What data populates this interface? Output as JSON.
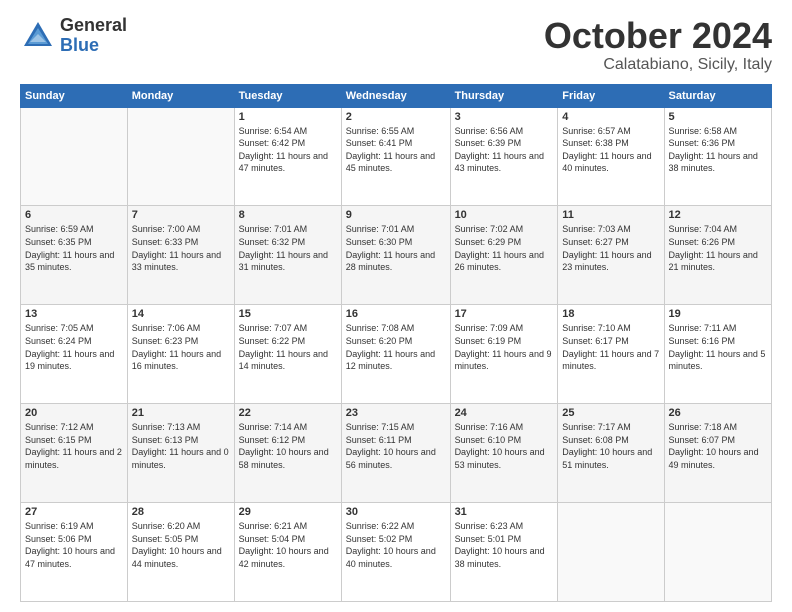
{
  "logo": {
    "general": "General",
    "blue": "Blue"
  },
  "title": "October 2024",
  "subtitle": "Calatabiano, Sicily, Italy",
  "days_of_week": [
    "Sunday",
    "Monday",
    "Tuesday",
    "Wednesday",
    "Thursday",
    "Friday",
    "Saturday"
  ],
  "weeks": [
    [
      {
        "day": "",
        "info": ""
      },
      {
        "day": "",
        "info": ""
      },
      {
        "day": "1",
        "info": "Sunrise: 6:54 AM\nSunset: 6:42 PM\nDaylight: 11 hours and 47 minutes."
      },
      {
        "day": "2",
        "info": "Sunrise: 6:55 AM\nSunset: 6:41 PM\nDaylight: 11 hours and 45 minutes."
      },
      {
        "day": "3",
        "info": "Sunrise: 6:56 AM\nSunset: 6:39 PM\nDaylight: 11 hours and 43 minutes."
      },
      {
        "day": "4",
        "info": "Sunrise: 6:57 AM\nSunset: 6:38 PM\nDaylight: 11 hours and 40 minutes."
      },
      {
        "day": "5",
        "info": "Sunrise: 6:58 AM\nSunset: 6:36 PM\nDaylight: 11 hours and 38 minutes."
      }
    ],
    [
      {
        "day": "6",
        "info": "Sunrise: 6:59 AM\nSunset: 6:35 PM\nDaylight: 11 hours and 35 minutes."
      },
      {
        "day": "7",
        "info": "Sunrise: 7:00 AM\nSunset: 6:33 PM\nDaylight: 11 hours and 33 minutes."
      },
      {
        "day": "8",
        "info": "Sunrise: 7:01 AM\nSunset: 6:32 PM\nDaylight: 11 hours and 31 minutes."
      },
      {
        "day": "9",
        "info": "Sunrise: 7:01 AM\nSunset: 6:30 PM\nDaylight: 11 hours and 28 minutes."
      },
      {
        "day": "10",
        "info": "Sunrise: 7:02 AM\nSunset: 6:29 PM\nDaylight: 11 hours and 26 minutes."
      },
      {
        "day": "11",
        "info": "Sunrise: 7:03 AM\nSunset: 6:27 PM\nDaylight: 11 hours and 23 minutes."
      },
      {
        "day": "12",
        "info": "Sunrise: 7:04 AM\nSunset: 6:26 PM\nDaylight: 11 hours and 21 minutes."
      }
    ],
    [
      {
        "day": "13",
        "info": "Sunrise: 7:05 AM\nSunset: 6:24 PM\nDaylight: 11 hours and 19 minutes."
      },
      {
        "day": "14",
        "info": "Sunrise: 7:06 AM\nSunset: 6:23 PM\nDaylight: 11 hours and 16 minutes."
      },
      {
        "day": "15",
        "info": "Sunrise: 7:07 AM\nSunset: 6:22 PM\nDaylight: 11 hours and 14 minutes."
      },
      {
        "day": "16",
        "info": "Sunrise: 7:08 AM\nSunset: 6:20 PM\nDaylight: 11 hours and 12 minutes."
      },
      {
        "day": "17",
        "info": "Sunrise: 7:09 AM\nSunset: 6:19 PM\nDaylight: 11 hours and 9 minutes."
      },
      {
        "day": "18",
        "info": "Sunrise: 7:10 AM\nSunset: 6:17 PM\nDaylight: 11 hours and 7 minutes."
      },
      {
        "day": "19",
        "info": "Sunrise: 7:11 AM\nSunset: 6:16 PM\nDaylight: 11 hours and 5 minutes."
      }
    ],
    [
      {
        "day": "20",
        "info": "Sunrise: 7:12 AM\nSunset: 6:15 PM\nDaylight: 11 hours and 2 minutes."
      },
      {
        "day": "21",
        "info": "Sunrise: 7:13 AM\nSunset: 6:13 PM\nDaylight: 11 hours and 0 minutes."
      },
      {
        "day": "22",
        "info": "Sunrise: 7:14 AM\nSunset: 6:12 PM\nDaylight: 10 hours and 58 minutes."
      },
      {
        "day": "23",
        "info": "Sunrise: 7:15 AM\nSunset: 6:11 PM\nDaylight: 10 hours and 56 minutes."
      },
      {
        "day": "24",
        "info": "Sunrise: 7:16 AM\nSunset: 6:10 PM\nDaylight: 10 hours and 53 minutes."
      },
      {
        "day": "25",
        "info": "Sunrise: 7:17 AM\nSunset: 6:08 PM\nDaylight: 10 hours and 51 minutes."
      },
      {
        "day": "26",
        "info": "Sunrise: 7:18 AM\nSunset: 6:07 PM\nDaylight: 10 hours and 49 minutes."
      }
    ],
    [
      {
        "day": "27",
        "info": "Sunrise: 6:19 AM\nSunset: 5:06 PM\nDaylight: 10 hours and 47 minutes."
      },
      {
        "day": "28",
        "info": "Sunrise: 6:20 AM\nSunset: 5:05 PM\nDaylight: 10 hours and 44 minutes."
      },
      {
        "day": "29",
        "info": "Sunrise: 6:21 AM\nSunset: 5:04 PM\nDaylight: 10 hours and 42 minutes."
      },
      {
        "day": "30",
        "info": "Sunrise: 6:22 AM\nSunset: 5:02 PM\nDaylight: 10 hours and 40 minutes."
      },
      {
        "day": "31",
        "info": "Sunrise: 6:23 AM\nSunset: 5:01 PM\nDaylight: 10 hours and 38 minutes."
      },
      {
        "day": "",
        "info": ""
      },
      {
        "day": "",
        "info": ""
      }
    ]
  ]
}
